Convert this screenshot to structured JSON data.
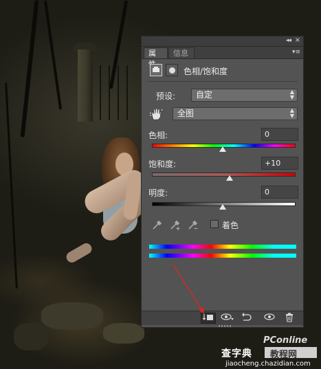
{
  "panel": {
    "tabs": [
      {
        "label": "属性",
        "active": true
      },
      {
        "label": "信息",
        "active": false
      }
    ],
    "header": {
      "title": "色相/饱和度",
      "icons": [
        "adjustment-layer-icon",
        "mask-icon"
      ]
    },
    "preset": {
      "label": "预设:",
      "value": "自定"
    },
    "channel": {
      "value": "全图",
      "icon": "hand-target-icon"
    },
    "hue": {
      "label": "色相:",
      "value": "0",
      "slider_fraction": 0.5
    },
    "saturation": {
      "label": "饱和度:",
      "value": "+10",
      "slider_fraction": 0.55
    },
    "lightness": {
      "label": "明度:",
      "value": "0",
      "slider_fraction": 0.5
    },
    "eyedroppers": [
      "eyedropper-icon",
      "eyedropper-plus-icon",
      "eyedropper-minus-icon"
    ],
    "colorize": {
      "label": "着色",
      "checked": false
    },
    "bottom_toolbar": [
      "clip-to-layer-icon",
      "view-previous-icon",
      "reset-icon",
      "visibility-icon",
      "trash-icon"
    ]
  },
  "annotation": {
    "arrow_color": "#e0261c"
  },
  "watermark": {
    "brand": "PConline",
    "site": "查字典",
    "tag": "教程网",
    "url": "jiaocheng.chazidian.com"
  }
}
